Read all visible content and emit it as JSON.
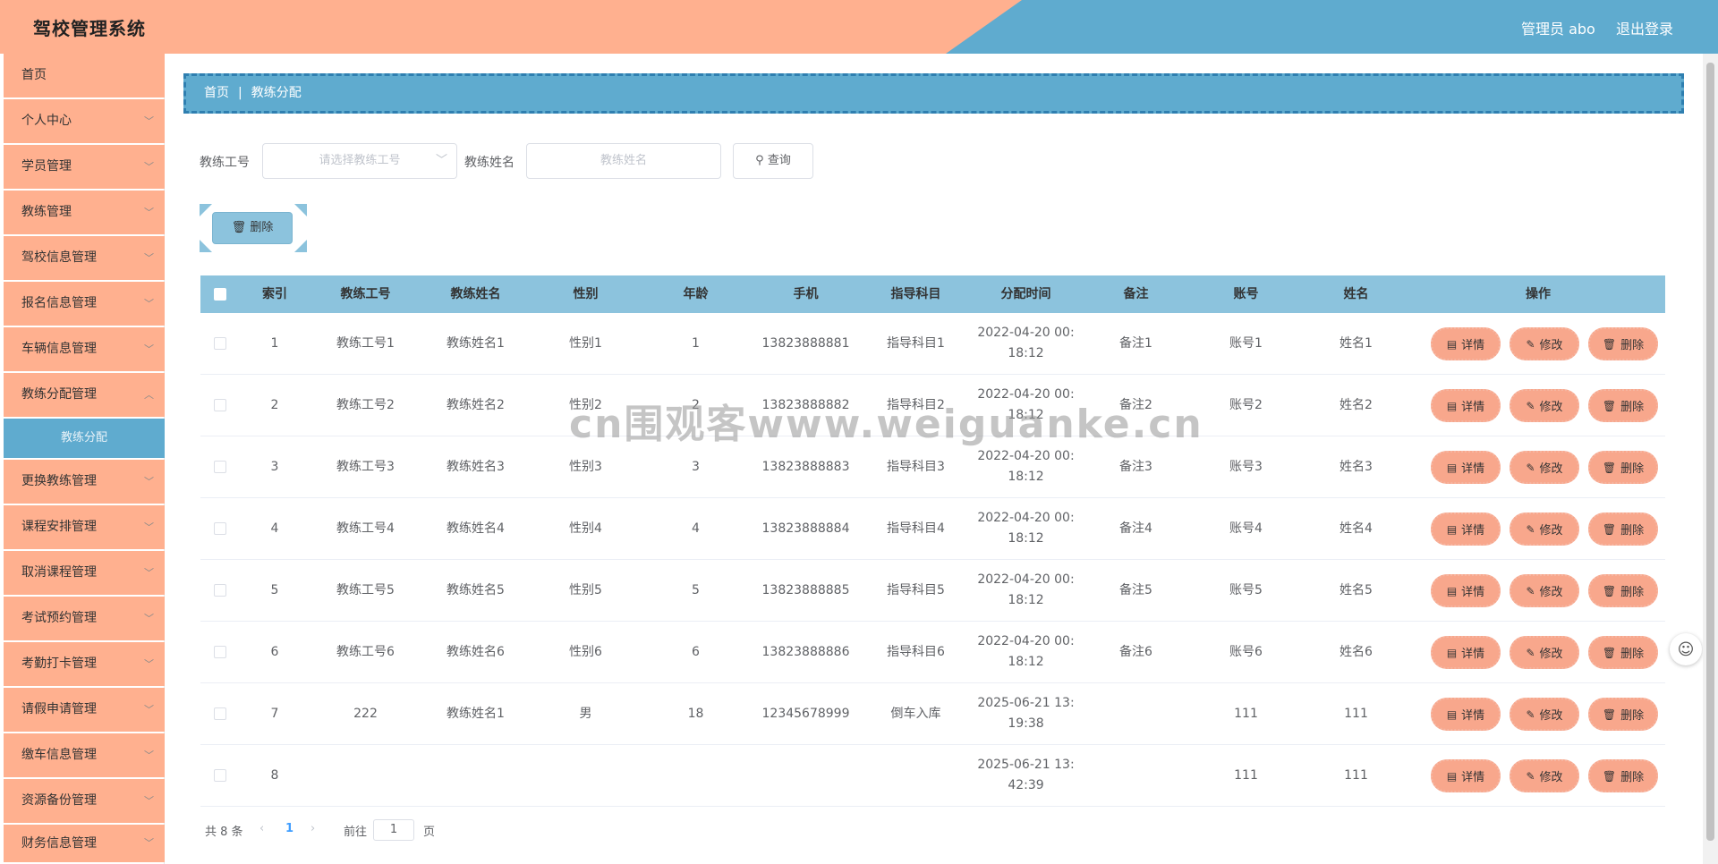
{
  "app": {
    "title": "驾校管理系统",
    "user": "管理员 abo",
    "logout": "退出登录"
  },
  "sidebar": {
    "items": [
      {
        "label": "首页"
      },
      {
        "label": "个人中心"
      },
      {
        "label": "学员管理"
      },
      {
        "label": "教练管理"
      },
      {
        "label": "驾校信息管理"
      },
      {
        "label": "报名信息管理"
      },
      {
        "label": "车辆信息管理"
      },
      {
        "label": "教练分配管理"
      },
      {
        "label": "教练分配"
      },
      {
        "label": "更换教练管理"
      },
      {
        "label": "课程安排管理"
      },
      {
        "label": "取消课程管理"
      },
      {
        "label": "考试预约管理"
      },
      {
        "label": "考勤打卡管理"
      },
      {
        "label": "请假申请管理"
      },
      {
        "label": "缴车信息管理"
      },
      {
        "label": "资源备份管理"
      },
      {
        "label": "财务信息管理"
      }
    ]
  },
  "breadcrumb": {
    "home": "首页",
    "sep": "|",
    "current": "教练分配"
  },
  "search": {
    "coach_no_label": "教练工号",
    "coach_no_placeholder": "请选择教练工号",
    "coach_name_label": "教练姓名",
    "coach_name_placeholder": "教练姓名",
    "query": "查询"
  },
  "toolbar": {
    "delete": "删除"
  },
  "table": {
    "headers": [
      "索引",
      "教练工号",
      "教练姓名",
      "性别",
      "年龄",
      "手机",
      "指导科目",
      "分配时间",
      "备注",
      "账号",
      "姓名",
      "操作"
    ],
    "rows": [
      {
        "idx": "1",
        "no": "教练工号1",
        "name": "教练姓名1",
        "sex": "性别1",
        "age": "1",
        "phone": "13823888881",
        "subject": "指导科目1",
        "t1": "2022-04-20 00:",
        "t2": "18:12",
        "note": "备注1",
        "acct": "账号1",
        "xm": "姓名1"
      },
      {
        "idx": "2",
        "no": "教练工号2",
        "name": "教练姓名2",
        "sex": "性别2",
        "age": "2",
        "phone": "13823888882",
        "subject": "指导科目2",
        "t1": "2022-04-20 00:",
        "t2": "18:12",
        "note": "备注2",
        "acct": "账号2",
        "xm": "姓名2"
      },
      {
        "idx": "3",
        "no": "教练工号3",
        "name": "教练姓名3",
        "sex": "性别3",
        "age": "3",
        "phone": "13823888883",
        "subject": "指导科目3",
        "t1": "2022-04-20 00:",
        "t2": "18:12",
        "note": "备注3",
        "acct": "账号3",
        "xm": "姓名3"
      },
      {
        "idx": "4",
        "no": "教练工号4",
        "name": "教练姓名4",
        "sex": "性别4",
        "age": "4",
        "phone": "13823888884",
        "subject": "指导科目4",
        "t1": "2022-04-20 00:",
        "t2": "18:12",
        "note": "备注4",
        "acct": "账号4",
        "xm": "姓名4"
      },
      {
        "idx": "5",
        "no": "教练工号5",
        "name": "教练姓名5",
        "sex": "性别5",
        "age": "5",
        "phone": "13823888885",
        "subject": "指导科目5",
        "t1": "2022-04-20 00:",
        "t2": "18:12",
        "note": "备注5",
        "acct": "账号5",
        "xm": "姓名5"
      },
      {
        "idx": "6",
        "no": "教练工号6",
        "name": "教练姓名6",
        "sex": "性别6",
        "age": "6",
        "phone": "13823888886",
        "subject": "指导科目6",
        "t1": "2022-04-20 00:",
        "t2": "18:12",
        "note": "备注6",
        "acct": "账号6",
        "xm": "姓名6"
      },
      {
        "idx": "7",
        "no": "222",
        "name": "教练姓名1",
        "sex": "男",
        "age": "18",
        "phone": "12345678999",
        "subject": "倒车入库",
        "t1": "2025-06-21 13:",
        "t2": "19:38",
        "note": "",
        "acct": "111",
        "xm": "111"
      },
      {
        "idx": "8",
        "no": "",
        "name": "",
        "sex": "",
        "age": "",
        "phone": "",
        "subject": "",
        "t1": "2025-06-21 13:",
        "t2": "42:39",
        "note": "",
        "acct": "111",
        "xm": "111"
      }
    ],
    "actions": {
      "detail": "详情",
      "edit": "修改",
      "delete": "删除"
    }
  },
  "pagination": {
    "total": "共 8 条",
    "prev": "‹",
    "page": "1",
    "next": "›",
    "goto": "前往",
    "goto_value": "1",
    "unit": "页"
  },
  "watermark": "cn围观客www.weiguanke.cn",
  "colors": {
    "header_left": "#ffb08f",
    "header_right": "#5fabcf",
    "menu": "#ffb08f",
    "table_head": "#8cc3dd",
    "action": "#f8a78c"
  }
}
